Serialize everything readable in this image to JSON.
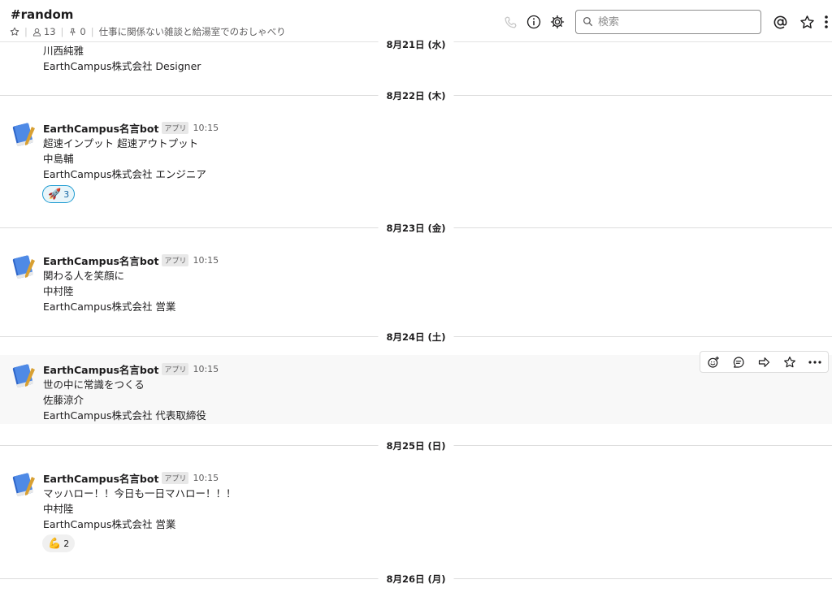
{
  "channel": {
    "name": "#random",
    "members": "13",
    "pins": "0",
    "topic": "仕事に関係ない雑談と給湯室でのおしゃべり"
  },
  "search": {
    "placeholder": "検索"
  },
  "partial_message": {
    "name_line": "川西純雅",
    "company_line": "EarthCampus株式会社 Designer"
  },
  "dividers": [
    "8月21日 (水)",
    "8月22日 (木)",
    "8月23日 (金)",
    "8月24日 (土)",
    "8月25日 (日)",
    "8月26日 (月)"
  ],
  "messages": [
    {
      "sender": "EarthCampus名言bot",
      "badge": "アプリ",
      "time": "10:15",
      "lines": [
        "超速インプット 超速アウトプット",
        "中島輔",
        "EarthCampus株式会社 エンジニア"
      ],
      "reaction": {
        "emoji": "🚀",
        "count": "3",
        "active": true
      }
    },
    {
      "sender": "EarthCampus名言bot",
      "badge": "アプリ",
      "time": "10:15",
      "lines": [
        "関わる人を笑顔に",
        "中村陸",
        "EarthCampus株式会社 営業"
      ]
    },
    {
      "sender": "EarthCampus名言bot",
      "badge": "アプリ",
      "time": "10:15",
      "lines": [
        "世の中に常識をつくる",
        "佐藤涼介",
        "EarthCampus株式会社 代表取締役"
      ]
    },
    {
      "sender": "EarthCampus名言bot",
      "badge": "アプリ",
      "time": "10:15",
      "lines": [
        "マッハロー！！今日も一日マハロー！！！",
        "中村陸",
        "EarthCampus株式会社 営業"
      ],
      "reaction": {
        "emoji": "💪",
        "count": "2",
        "active": false
      }
    }
  ],
  "colors": {
    "accent": "#1264a3",
    "divider": "#dddddd",
    "hover_bg": "#f8f8f8"
  }
}
